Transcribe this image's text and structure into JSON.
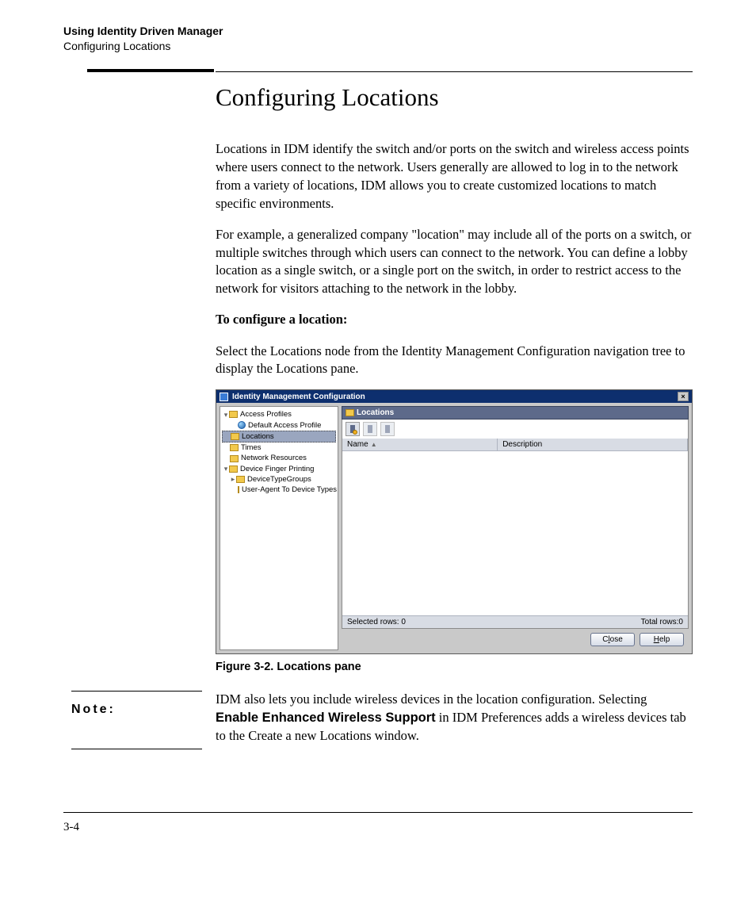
{
  "header": {
    "chapter": "Using Identity Driven Manager",
    "section": "Configuring Locations"
  },
  "title": "Configuring Locations",
  "paragraphs": {
    "p1": "Locations in IDM identify the switch and/or ports on the switch and wireless access points where users connect to the network. Users generally are allowed to log in to the network from a variety of locations, IDM allows you to create customized locations to match specific environments.",
    "p2": "For example, a generalized company \"location\" may include all of the ports on a switch, or multiple switches through which users can connect to the network. You can define a lobby location as a single switch, or a single port on the switch, in order to restrict access to the network for visitors attaching to the network in the lobby.",
    "p3_bold": "To configure a location:",
    "p4": "Select the Locations node from the Identity Management Configuration navigation tree to display the Locations pane."
  },
  "window": {
    "title": "Identity Management Configuration",
    "close_label": "×",
    "tree": {
      "n0": "Access Profiles",
      "n1": "Default Access Profile",
      "n2": "Locations",
      "n3": "Times",
      "n4": "Network Resources",
      "n5": "Device Finger Printing",
      "n6": "DeviceTypeGroups",
      "n7": "User-Agent To Device Types"
    },
    "pane_title": "Locations",
    "columns": {
      "name": "Name",
      "desc": "Description"
    },
    "status": {
      "left": "Selected rows: 0",
      "right": "Total rows:0"
    },
    "buttons": {
      "close_pre": "C",
      "close_ul": "l",
      "close_post": "ose",
      "help_pre": "",
      "help_ul": "H",
      "help_post": "elp"
    }
  },
  "figure_caption": "Figure 3-2. Locations pane",
  "note": {
    "label": "Note:",
    "text_pre": "IDM also lets you include wireless devices in the location configuration. Selecting ",
    "text_bold": "Enable Enhanced Wireless Support",
    "text_post": " in IDM Preferences adds a wireless devices tab to the Create a new Locations window."
  },
  "page_number": "3-4"
}
